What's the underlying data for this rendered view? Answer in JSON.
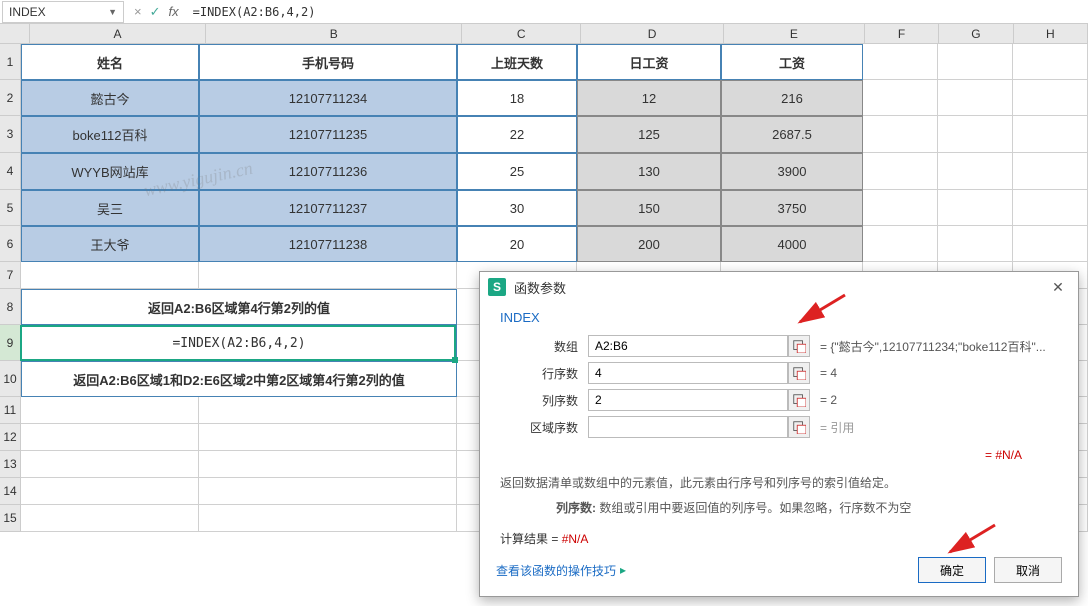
{
  "formula_bar": {
    "name_box": "INDEX",
    "formula": "=INDEX(A2:B6,4,2)",
    "cancel_glyph": "×",
    "accept_glyph": "✓",
    "fx_glyph": "fx"
  },
  "columns": [
    "A",
    "B",
    "C",
    "D",
    "E",
    "F",
    "G",
    "H"
  ],
  "row_heights": {
    "r1": 36,
    "r2": 36,
    "r3": 37,
    "r4": 37,
    "r5": 36,
    "r6": 36,
    "r7": 27,
    "r8": 36,
    "r9": 36,
    "r10": 36,
    "r11": 27,
    "r12": 27,
    "r13": 27,
    "r14": 27,
    "r15": 27
  },
  "table": {
    "headers": {
      "A": "姓名",
      "B": "手机号码",
      "C": "上班天数",
      "D": "日工资",
      "E": "工资"
    },
    "rows": [
      {
        "A": "懿古今",
        "B": "12107711234",
        "C": "18",
        "D": "12",
        "E": "216"
      },
      {
        "A": "boke112百科",
        "B": "12107711235",
        "C": "22",
        "D": "125",
        "E": "2687.5"
      },
      {
        "A": "WYYB网站库",
        "B": "12107711236",
        "C": "25",
        "D": "130",
        "E": "3900"
      },
      {
        "A": "吴三",
        "B": "12107711237",
        "C": "30",
        "D": "150",
        "E": "3750"
      },
      {
        "A": "王大爷",
        "B": "12107711238",
        "C": "20",
        "D": "200",
        "E": "4000"
      }
    ]
  },
  "row8_text": "返回A2:B6区域第4行第2列的值",
  "row9_text": "=INDEX(A2:B6,4,2)",
  "row10_text": "返回A2:B6区域1和D2:E6区域2中第2区域第4行第2列的值",
  "dialog": {
    "title": "函数参数",
    "func": "INDEX",
    "params": {
      "array_label": "数组",
      "array_value": "A2:B6",
      "array_result": "= {\"懿古今\",12107711234;\"boke112百科\"...",
      "row_label": "行序数",
      "row_value": "4",
      "row_result": "= 4",
      "col_label": "列序数",
      "col_value": "2",
      "col_result": "= 2",
      "area_label": "区域序数",
      "area_value": "",
      "area_result": "= 引用"
    },
    "na_equals": "= ",
    "na_text": "#N/A",
    "desc1": "返回数据清单或数组中的元素值，此元素由行序号和列序号的索引值给定。",
    "desc2_label": "列序数:",
    "desc2_text": " 数组或引用中要返回值的列序号。如果忽略，行序数不为空",
    "calc_label": "计算结果 = ",
    "calc_result": "#N/A",
    "help_link": "查看该函数的操作技巧",
    "help_icon": "▸",
    "ok": "确定",
    "cancel": "取消"
  },
  "watermark": "www.yigujin.cn"
}
